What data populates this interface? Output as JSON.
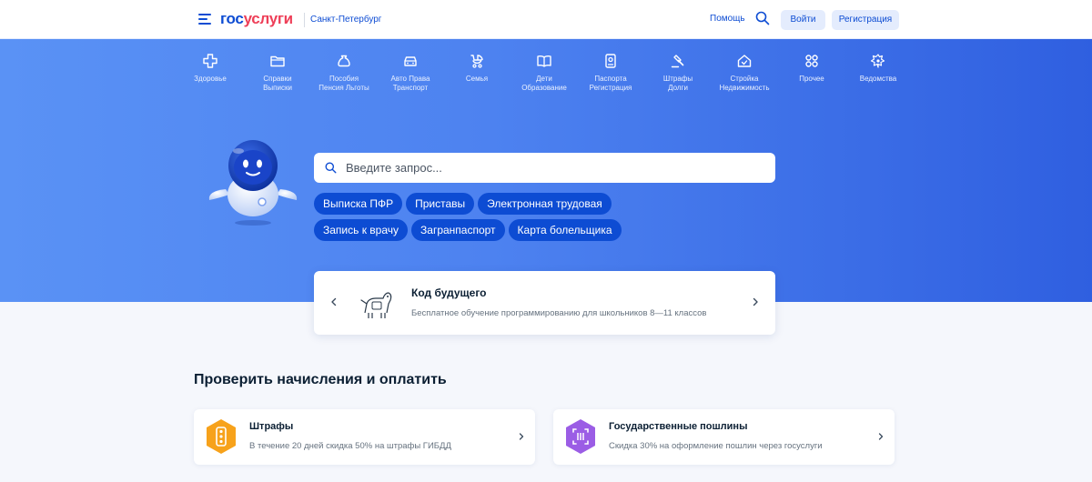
{
  "header": {
    "logo_part1": "гос",
    "logo_part2": "услуги",
    "region": "Санкт-Петербург",
    "help": "Помощь",
    "login": "Войти",
    "register": "Регистрация"
  },
  "categories": [
    {
      "l1": "Здоровье",
      "l2": ""
    },
    {
      "l1": "Справки",
      "l2": "Выписки"
    },
    {
      "l1": "Пособия",
      "l2": "Пенсия Льготы"
    },
    {
      "l1": "Авто Права",
      "l2": "Транспорт"
    },
    {
      "l1": "Семья",
      "l2": ""
    },
    {
      "l1": "Дети",
      "l2": "Образование"
    },
    {
      "l1": "Паспорта",
      "l2": "Регистрация"
    },
    {
      "l1": "Штрафы",
      "l2": "Долги"
    },
    {
      "l1": "Стройка",
      "l2": "Недвижимость"
    },
    {
      "l1": "Прочее",
      "l2": ""
    },
    {
      "l1": "Ведомства",
      "l2": ""
    }
  ],
  "search": {
    "placeholder": "Введите запрос..."
  },
  "chips": [
    "Выписка ПФР",
    "Приставы",
    "Электронная трудовая",
    "Запись к врачу",
    "Загранпаспорт",
    "Карта болельщика"
  ],
  "promo": {
    "title": "Код будущего",
    "subtitle": "Бесплатное обучение программированию для школьников 8—11 классов"
  },
  "section": {
    "title": "Проверить начисления и оплатить"
  },
  "cards": [
    {
      "title": "Штрафы",
      "subtitle": "В течение 20 дней скидка 50% на штрафы ГИБДД",
      "color": "#f7a21b"
    },
    {
      "title": "Государственные пошлины",
      "subtitle": "Скидка 30% на оформление пошлин через госуслуги",
      "color": "#9b5de5"
    }
  ],
  "colors": {
    "brand_blue": "#0d4cd3",
    "brand_red": "#ee3f58",
    "hero_start": "#5a92f5",
    "hero_end": "#2f5fe0"
  }
}
